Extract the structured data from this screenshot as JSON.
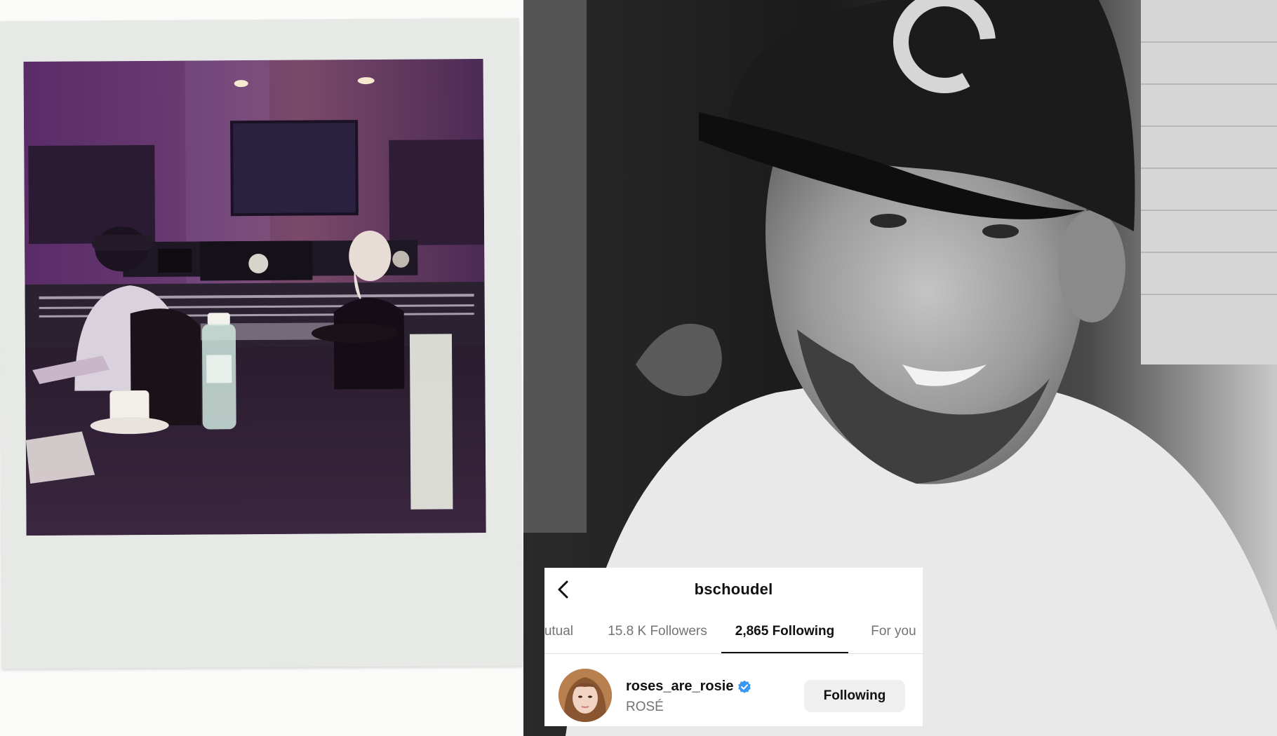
{
  "profile_header": {
    "title": "bschoudel",
    "back_icon": "chevron-left-icon"
  },
  "tabs": [
    {
      "label": "Mutual",
      "active": false
    },
    {
      "label": "15.8 K Followers",
      "active": false
    },
    {
      "label": "2,865 Following",
      "active": true
    },
    {
      "label": "For you",
      "active": false
    }
  ],
  "following_list": [
    {
      "username": "roses_are_rosie",
      "full_name": "ROSÉ",
      "verified": true,
      "button_label": "Following"
    }
  ],
  "colors": {
    "verified_badge": "#3897f0",
    "secondary_text": "#737373",
    "button_bg": "#efefef"
  }
}
